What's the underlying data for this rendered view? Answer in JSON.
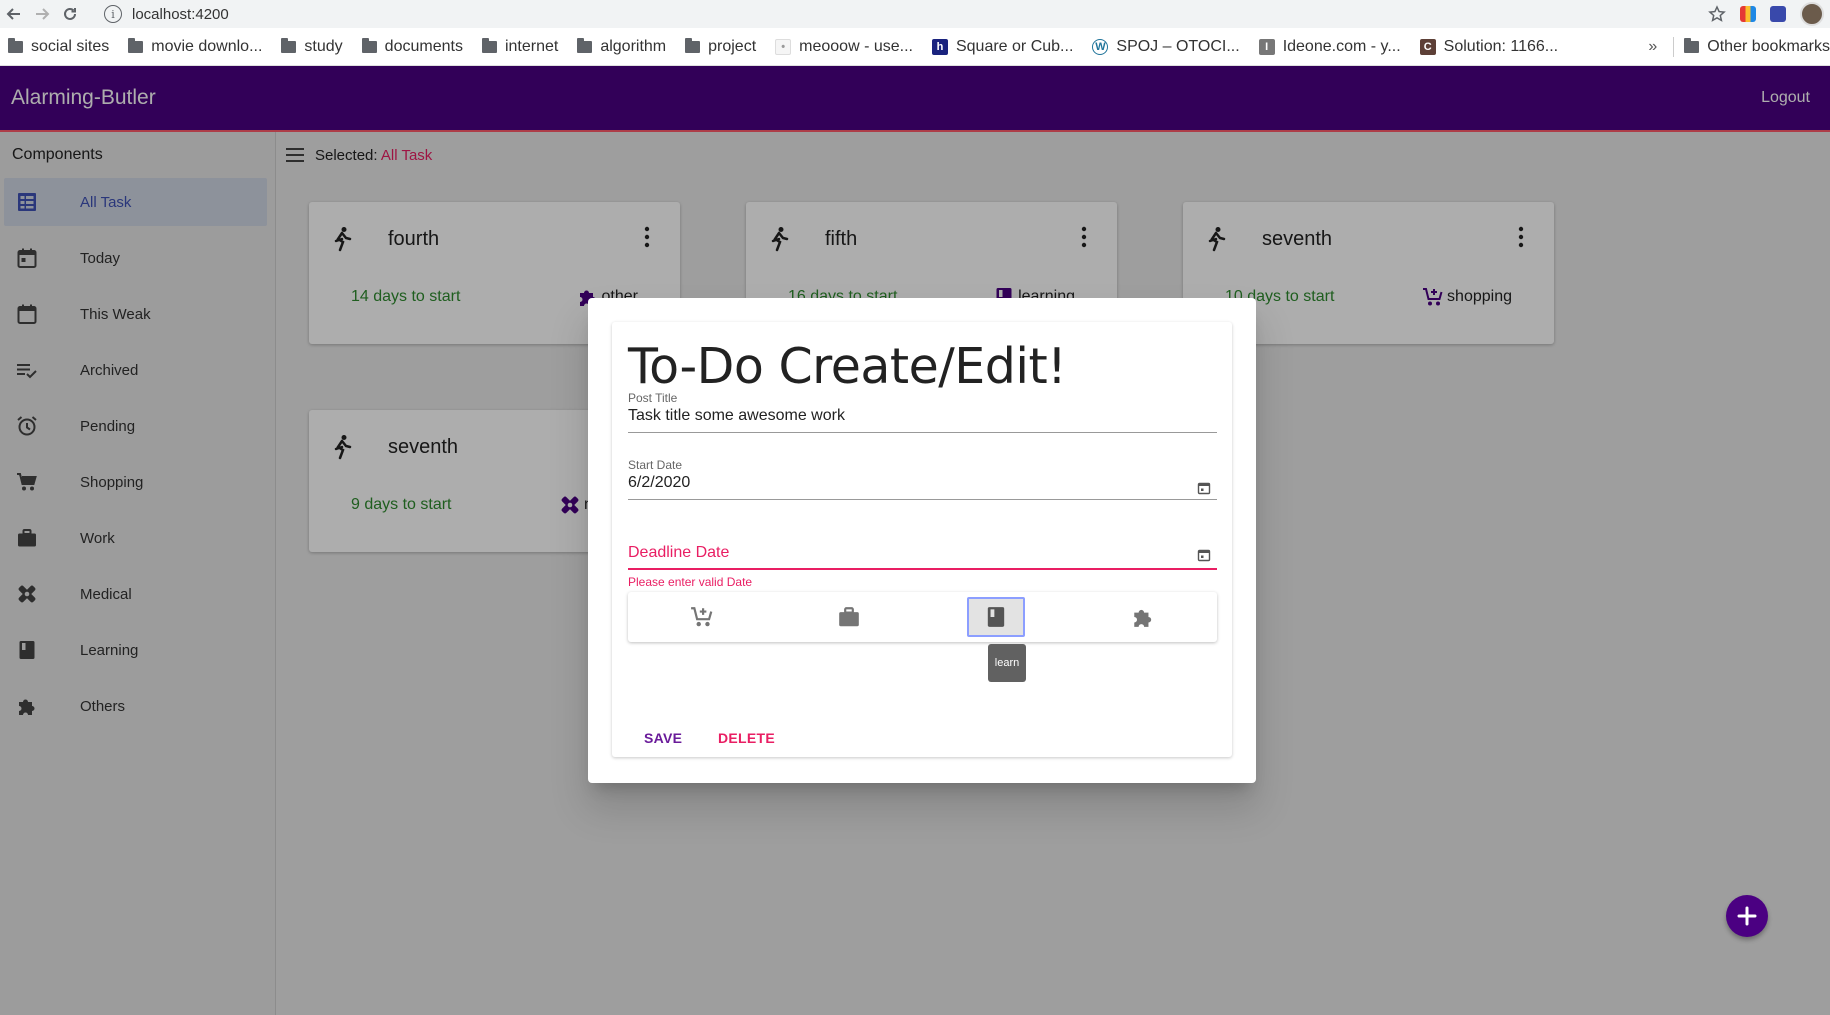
{
  "browser": {
    "url": "localhost:4200",
    "bookmarks": [
      {
        "label": "social sites",
        "icon": "folder-icon"
      },
      {
        "label": "movie downlo...",
        "icon": "folder-icon"
      },
      {
        "label": "study",
        "icon": "folder-icon"
      },
      {
        "label": "documents",
        "icon": "folder-icon"
      },
      {
        "label": "internet",
        "icon": "folder-icon"
      },
      {
        "label": "algorithm",
        "icon": "folder-icon"
      },
      {
        "label": "project",
        "icon": "folder-icon"
      },
      {
        "label": "meooow - use...",
        "icon": "favicon"
      },
      {
        "label": "Square or Cub...",
        "icon": "favicon"
      },
      {
        "label": "SPOJ – OTOCI...",
        "icon": "favicon"
      },
      {
        "label": "Ideone.com - y...",
        "icon": "favicon"
      },
      {
        "label": "Solution: 1166...",
        "icon": "favicon"
      }
    ],
    "more": "»",
    "other_bookmarks": "Other bookmarks"
  },
  "app": {
    "title": "Alarming-Butler",
    "logout": "Logout",
    "brand_color": "#4b0082"
  },
  "sidebar": {
    "heading": "Components",
    "items": [
      {
        "label": "All Task",
        "icon": "dashboard-icon",
        "active": true
      },
      {
        "label": "Today",
        "icon": "calendar-today-icon"
      },
      {
        "label": "This Weak",
        "icon": "calendar-icon"
      },
      {
        "label": "Archived",
        "icon": "playlist-check-icon"
      },
      {
        "label": "Pending",
        "icon": "alarm-icon"
      },
      {
        "label": "Shopping",
        "icon": "cart-icon"
      },
      {
        "label": "Work",
        "icon": "briefcase-icon"
      },
      {
        "label": "Medical",
        "icon": "bandage-icon"
      },
      {
        "label": "Learning",
        "icon": "book-icon"
      },
      {
        "label": "Others",
        "icon": "puzzle-icon"
      }
    ]
  },
  "main": {
    "selected_label": "Selected:",
    "selected_value": "All Task",
    "cards": [
      {
        "title": "fourth",
        "days": "14 days to start",
        "category": "other",
        "icon": "puzzle-icon"
      },
      {
        "title": "fifth",
        "days": "16 days to start",
        "category": "learning",
        "icon": "book-icon"
      },
      {
        "title": "seventh",
        "days": "10 days to start",
        "category": "shopping",
        "icon": "cart-add-icon"
      },
      {
        "title": "seventh",
        "days": "9 days to start",
        "category": "m",
        "icon": "bandage-icon"
      }
    ]
  },
  "dialog": {
    "title": "To-Do Create/Edit!",
    "post_title_label": "Post Title",
    "post_title_value": "Task title some awesome work",
    "start_date_label": "Start Date",
    "start_date_value": "6/2/2020",
    "deadline_placeholder": "Deadline Date",
    "deadline_error": "Please enter valid Date",
    "categories": [
      {
        "name": "shopping",
        "icon": "cart-add-icon"
      },
      {
        "name": "work",
        "icon": "briefcase-icon"
      },
      {
        "name": "learn",
        "icon": "book-icon",
        "selected": true
      },
      {
        "name": "other",
        "icon": "puzzle-icon"
      }
    ],
    "tooltip": "learn",
    "save": "SAVE",
    "delete": "DELETE",
    "error_color": "#e91e63"
  }
}
